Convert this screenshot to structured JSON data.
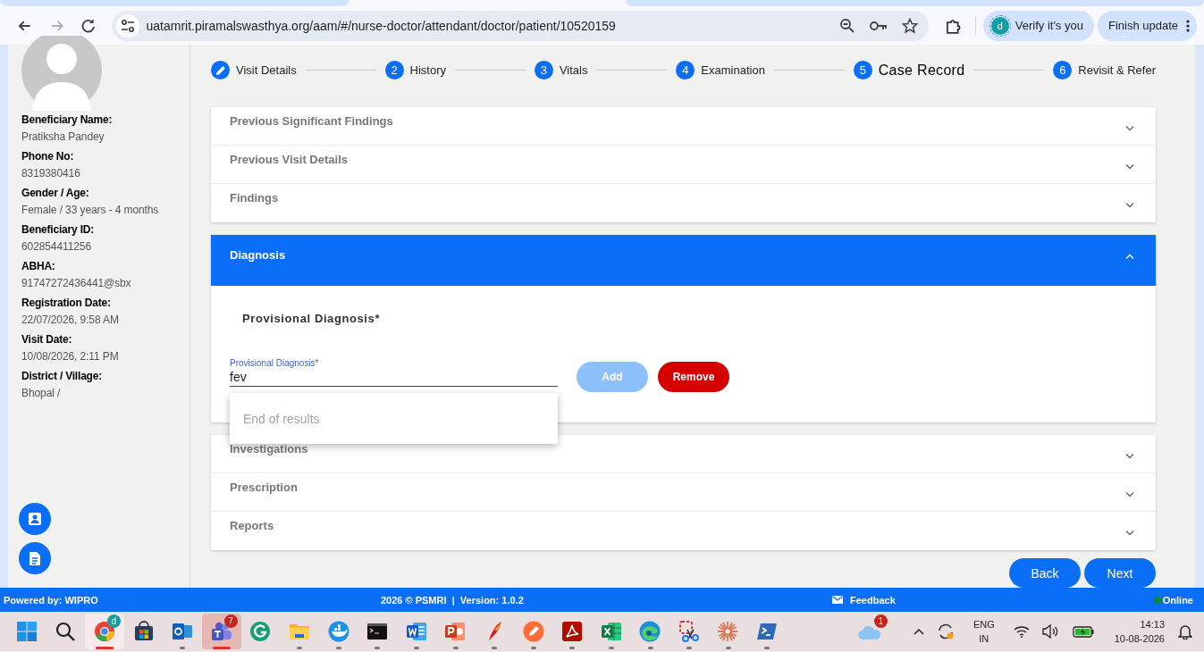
{
  "browser": {
    "url": "uatamrit.piramalswasthya.org/aam/#/nurse-doctor/attendant/doctor/patient/10520159",
    "forward_disabled": true,
    "profile": {
      "initial": "d",
      "label": "Verify it's you"
    },
    "update_label": "Finish update"
  },
  "sidebar": {
    "fields": [
      {
        "label": "Beneficiary Name:",
        "value": "Pratiksha Pandey"
      },
      {
        "label": "Phone No:",
        "value": "8319380416"
      },
      {
        "label": "Gender / Age:",
        "value": "Female / 33 years - 4 months"
      },
      {
        "label": "Beneficiary ID:",
        "value": "602854411256"
      },
      {
        "label": "ABHA:",
        "value": "91747272436441@sbx"
      },
      {
        "label": "Registration Date:",
        "value": "22/07/2026, 9:58 AM"
      },
      {
        "label": "Visit Date:",
        "value": "10/08/2026, 2:11 PM"
      },
      {
        "label": "District / Village:",
        "value": "Bhopal /"
      }
    ]
  },
  "stepper": [
    {
      "label": "Visit Details",
      "completed": true,
      "selected": false
    },
    {
      "number": "2",
      "label": "History",
      "completed": false,
      "selected": false
    },
    {
      "number": "3",
      "label": "Vitals",
      "completed": false,
      "selected": false
    },
    {
      "number": "4",
      "label": "Examination",
      "completed": false,
      "selected": false
    },
    {
      "number": "5",
      "label": "Case Record",
      "completed": false,
      "selected": true
    },
    {
      "number": "6",
      "label": "Revisit & Refer",
      "completed": false,
      "selected": false
    }
  ],
  "section_groups": [
    {
      "sections": [
        {
          "title": "Previous Significant Findings",
          "expanded": false
        },
        {
          "title": "Previous Visit Details",
          "expanded": false
        },
        {
          "title": "Findings",
          "expanded": false
        }
      ]
    },
    {
      "sections": [
        {
          "title": "Diagnosis",
          "expanded": true,
          "content": {
            "heading": "Provisional Diagnosis*",
            "field": {
              "label": "Provisional Diagnosis*",
              "value": "fev"
            },
            "suggestions_message": "End of results",
            "buttons": [
              {
                "label": "Add",
                "kind": "add",
                "disabled": true
              },
              {
                "label": "Remove",
                "kind": "remove",
                "disabled": false
              }
            ]
          }
        }
      ]
    },
    {
      "sections": [
        {
          "title": "Investigations",
          "expanded": false
        },
        {
          "title": "Prescription",
          "expanded": false
        },
        {
          "title": "Reports",
          "expanded": false
        }
      ]
    }
  ],
  "nav_buttons": [
    "Back",
    "Next"
  ],
  "footer": {
    "powered_by": "Powered by: WIPRO",
    "copyright": "2026 © PSMRI  |  Version: 1.0.2",
    "feedback": "Feedback",
    "status": {
      "label": "Online",
      "online": true
    }
  },
  "taskbar": {
    "apps": [
      {
        "kind": "windows",
        "running": false,
        "active": false
      },
      {
        "kind": "search",
        "running": false,
        "active": false
      },
      {
        "kind": "browser",
        "badge": "d",
        "running": true,
        "active": true
      },
      {
        "kind": "store",
        "running": false,
        "active": false
      },
      {
        "kind": "mail",
        "running": true,
        "active": false
      },
      {
        "kind": "chat",
        "badge": "7",
        "running": true,
        "active": true
      },
      {
        "kind": "gcircle",
        "running": false,
        "active": false
      },
      {
        "kind": "folder",
        "running": true,
        "active": false
      },
      {
        "kind": "whale",
        "running": true,
        "active": false
      },
      {
        "kind": "terminal",
        "running": true,
        "active": false
      },
      {
        "kind": "word",
        "running": true,
        "active": false
      },
      {
        "kind": "slides",
        "running": true,
        "active": false
      },
      {
        "kind": "feather",
        "running": true,
        "active": false
      },
      {
        "kind": "orange",
        "running": true,
        "active": false
      },
      {
        "kind": "pdf",
        "running": true,
        "active": false
      },
      {
        "kind": "sheet",
        "running": true,
        "active": false
      },
      {
        "kind": "wave",
        "running": true,
        "active": false
      },
      {
        "kind": "scissors",
        "running": true,
        "active": false
      },
      {
        "kind": "starburst",
        "running": true,
        "active": false
      },
      {
        "kind": "shell",
        "running": true,
        "active": false
      }
    ],
    "tray": {
      "cloud_badge": "1",
      "language": "ENG",
      "region": "IN",
      "time": "14:13",
      "date": "10-08-2026"
    }
  }
}
